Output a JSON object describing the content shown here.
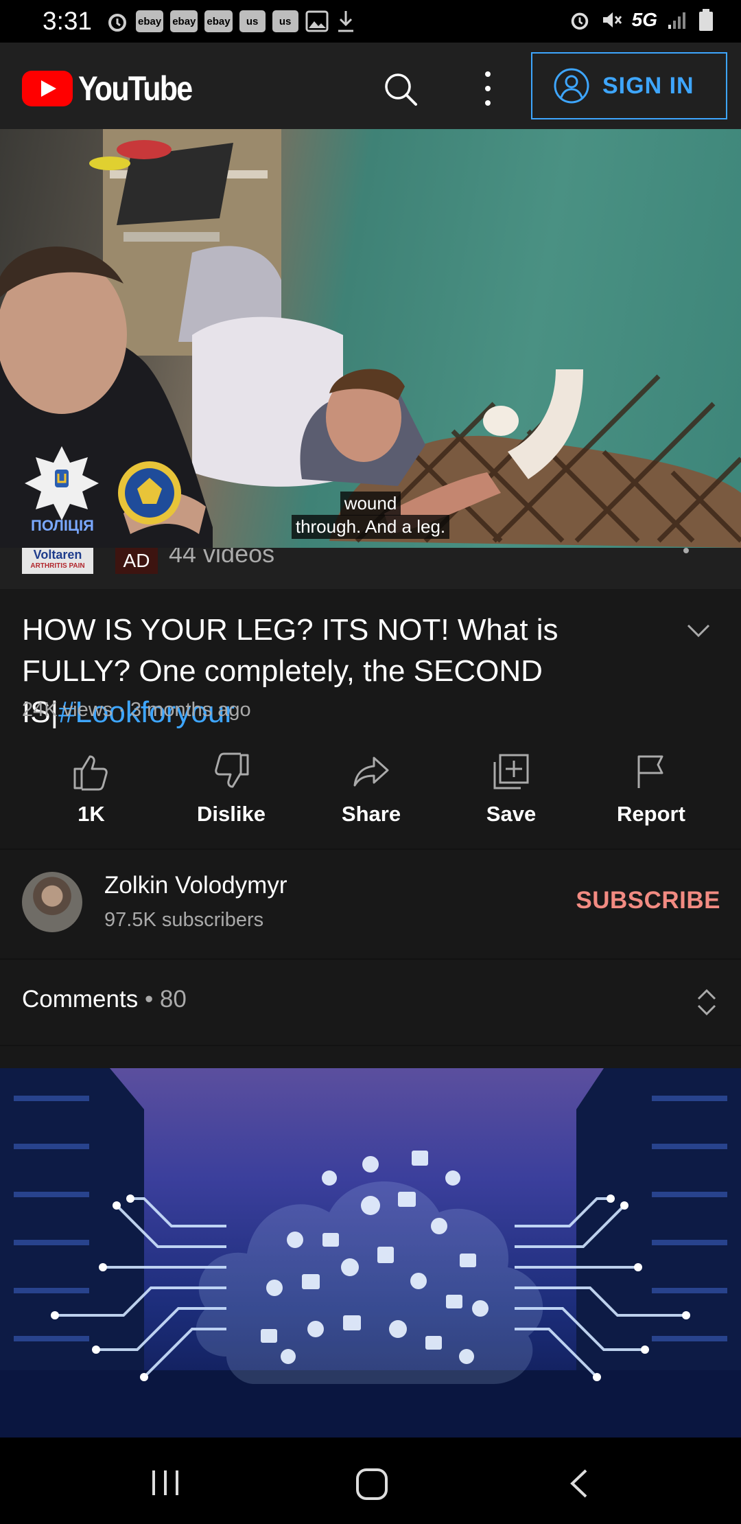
{
  "status_bar": {
    "time": "3:31",
    "notification_icons": [
      "ebay",
      "ebay",
      "ebay",
      "us",
      "us"
    ],
    "network": "5G"
  },
  "header": {
    "logo_text": "YouTube",
    "sign_in_label": "SIGN IN"
  },
  "video": {
    "captions": [
      "wound",
      "through. And a leg."
    ],
    "badge_text": "ПОЛІЦІЯ"
  },
  "ad": {
    "thumb_text": "Voltaren",
    "thumb_subtext": "ARTHRITIS PAIN",
    "badge": "AD",
    "text": "44 videos"
  },
  "video_info": {
    "title": "HOW IS YOUR LEG? ITS NOT! What is FULLY? One completely, the SECOND IS|",
    "hashtag": "#Lookforyour",
    "meta": "24K views · 3 months ago"
  },
  "actions": [
    {
      "label": "1K",
      "icon": "thumbs-up-icon"
    },
    {
      "label": "Dislike",
      "icon": "thumbs-down-icon"
    },
    {
      "label": "Share",
      "icon": "share-icon"
    },
    {
      "label": "Save",
      "icon": "playlist-add-icon"
    },
    {
      "label": "Report",
      "icon": "flag-icon"
    }
  ],
  "channel": {
    "name": "Zolkin Volodymyr",
    "subscribers": "97.5K subscribers",
    "subscribe_label": "SUBSCRIBE"
  },
  "comments": {
    "label": "Comments",
    "count": "80"
  },
  "colors": {
    "background": "#181818",
    "accent_blue": "#3ea6ff",
    "subscribe_red": "#f28b82",
    "youtube_red": "#ff0000"
  }
}
